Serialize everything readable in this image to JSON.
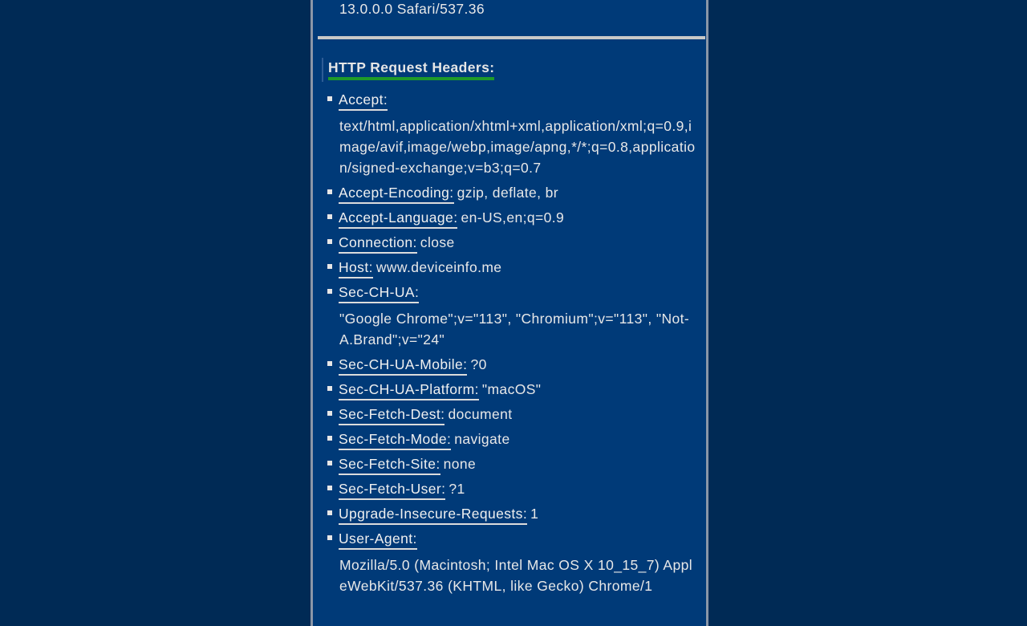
{
  "top_value": "13.0.0.0 Safari/537.36",
  "section_title": "HTTP Request Headers:",
  "headers": [
    {
      "key": "Accept:",
      "value": "text/html,application/xhtml+xml,application/xml;q=0.9,image/avif,image/webp,image/apng,*/*;q=0.8,application/signed-exchange;v=b3;q=0.7"
    },
    {
      "key": "Accept-Encoding:",
      "value": "gzip, deflate, br"
    },
    {
      "key": "Accept-Language:",
      "value": "en-US,en;q=0.9"
    },
    {
      "key": "Connection:",
      "value": "close"
    },
    {
      "key": "Host:",
      "value": "www.deviceinfo.me"
    },
    {
      "key": "Sec-CH-UA:",
      "value": "\"Google Chrome\";v=\"113\", \"Chromium\";v=\"113\", \"Not-A.Brand\";v=\"24\""
    },
    {
      "key": "Sec-CH-UA-Mobile:",
      "value": "?0"
    },
    {
      "key": "Sec-CH-UA-Platform:",
      "value": "\"macOS\""
    },
    {
      "key": "Sec-Fetch-Dest:",
      "value": "document"
    },
    {
      "key": "Sec-Fetch-Mode:",
      "value": "navigate"
    },
    {
      "key": "Sec-Fetch-Site:",
      "value": "none"
    },
    {
      "key": "Sec-Fetch-User:",
      "value": "?1"
    },
    {
      "key": "Upgrade-Insecure-Requests:",
      "value": "1"
    },
    {
      "key": "User-Agent:",
      "value": "Mozilla/5.0 (Macintosh; Intel Mac OS X 10_15_7) AppleWebKit/537.36 (KHTML, like Gecko) Chrome/1"
    }
  ],
  "colors": {
    "page_background": "#002a55",
    "panel_background": "#003a78",
    "heading_underline": "#1f9a2a",
    "text": "#e8e8e8"
  }
}
